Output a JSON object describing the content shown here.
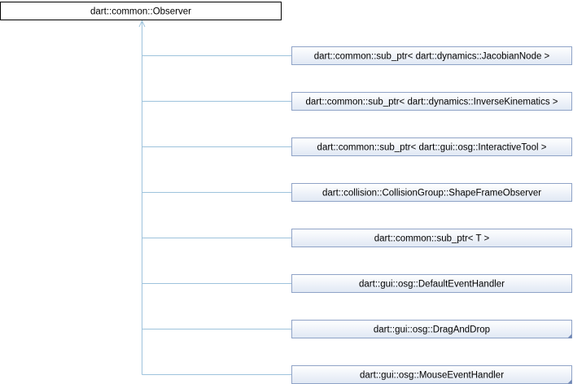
{
  "base_class": {
    "label": "dart::common::Observer"
  },
  "derived_classes": [
    {
      "label": "dart::common::sub_ptr< dart::dynamics::JacobianNode >",
      "truncated": false
    },
    {
      "label": "dart::common::sub_ptr< dart::dynamics::InverseKinematics >",
      "truncated": false
    },
    {
      "label": "dart::common::sub_ptr< dart::gui::osg::InteractiveTool >",
      "truncated": false
    },
    {
      "label": "dart::collision::CollisionGroup::ShapeFrameObserver",
      "truncated": false
    },
    {
      "label": "dart::common::sub_ptr< T >",
      "truncated": false
    },
    {
      "label": "dart::gui::osg::DefaultEventHandler",
      "truncated": false
    },
    {
      "label": "dart::gui::osg::DragAndDrop",
      "truncated": true
    },
    {
      "label": "dart::gui::osg::MouseEventHandler",
      "truncated": true
    }
  ],
  "colors": {
    "base_fill": "#ffffff",
    "base_stroke": "#000000",
    "node_fill_top": "#ffffff",
    "node_fill_bottom": "#e0e8f4",
    "node_stroke": "#8fa3c7",
    "edge": "#9ec3dc",
    "corner_marker": "#6f86b4"
  }
}
